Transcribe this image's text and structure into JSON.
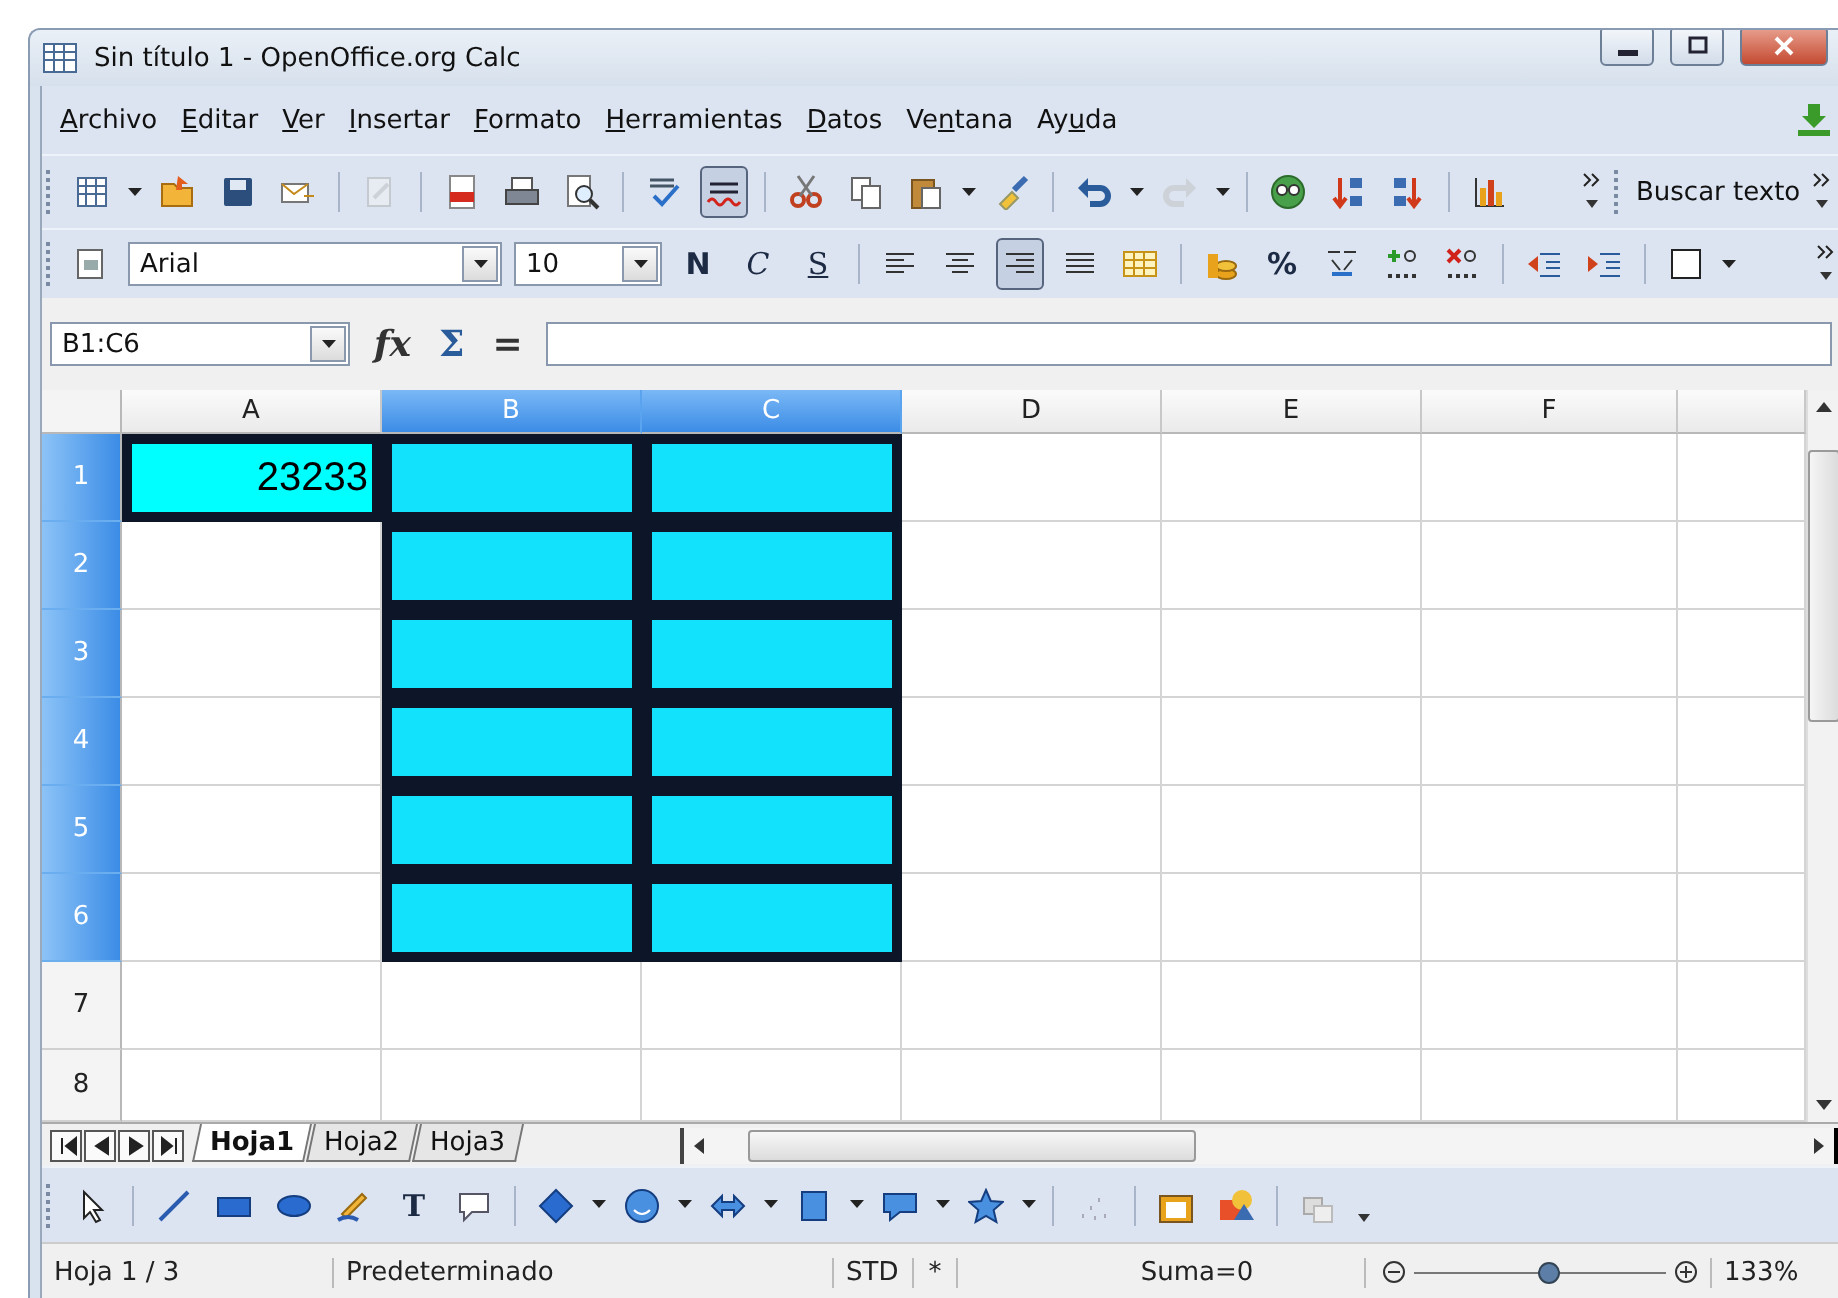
{
  "window": {
    "title": "Sin título 1 - OpenOffice.org Calc"
  },
  "menu": [
    {
      "key": "A",
      "post": "rchivo"
    },
    {
      "key": "E",
      "post": "ditar"
    },
    {
      "key": "V",
      "post": "er"
    },
    {
      "key": "I",
      "post": "nsertar"
    },
    {
      "key": "F",
      "post": "ormato"
    },
    {
      "key": "H",
      "post": "erramientas"
    },
    {
      "key": "D",
      "post": "atos"
    },
    {
      "pre": "Ve",
      "key": "n",
      "post": "tana"
    },
    {
      "pre": "Ay",
      "key": "u",
      "post": "da"
    }
  ],
  "standard_toolbar": {
    "auto_spellcheck": {
      "on": true
    },
    "edit_file": {
      "disabled": true
    },
    "redo": {
      "disabled": true
    },
    "find_label": "Buscar texto"
  },
  "format_toolbar": {
    "font": "Arial",
    "size": "10",
    "bold_glyph": "N",
    "italic_glyph": "C",
    "underline_glyph": "S",
    "percent_glyph": "%",
    "align_right": {
      "on": true
    }
  },
  "formula_bar": {
    "name_box": "B1:C6",
    "function_glyph": "fx",
    "sum_glyph": "Σ",
    "equals_glyph": "="
  },
  "columns": [
    {
      "label": "A",
      "selected": false
    },
    {
      "label": "B",
      "selected": true
    },
    {
      "label": "C",
      "selected": true
    },
    {
      "label": "D",
      "selected": false
    },
    {
      "label": "E",
      "selected": false
    },
    {
      "label": "F",
      "selected": false
    }
  ],
  "rows": [
    {
      "label": "1",
      "selected": true,
      "cells": [
        {
          "value": "23233",
          "color": "#00ffff"
        },
        {
          "color": "#12e2fb"
        },
        {
          "color": "#12e2fb"
        }
      ]
    },
    {
      "label": "2",
      "selected": true,
      "cells": [
        {},
        {
          "color": "#12e2fb"
        },
        {
          "color": "#12e2fb"
        }
      ]
    },
    {
      "label": "3",
      "selected": true,
      "cells": [
        {},
        {
          "color": "#12e2fb"
        },
        {
          "color": "#12e2fb"
        }
      ]
    },
    {
      "label": "4",
      "selected": true,
      "cells": [
        {},
        {
          "color": "#12e2fb"
        },
        {
          "color": "#12e2fb"
        }
      ]
    },
    {
      "label": "5",
      "selected": true,
      "cells": [
        {},
        {
          "color": "#12e2fb"
        },
        {
          "color": "#12e2fb"
        }
      ]
    },
    {
      "label": "6",
      "selected": true,
      "cells": [
        {},
        {
          "color": "#12e2fb"
        },
        {
          "color": "#12e2fb"
        }
      ]
    },
    {
      "label": "7",
      "selected": false,
      "cells": []
    },
    {
      "label": "8",
      "selected": false,
      "cells": []
    }
  ],
  "sheet_tabs": [
    {
      "label": "Hoja1",
      "selected": true
    },
    {
      "label": "Hoja2",
      "selected": false
    },
    {
      "label": "Hoja3",
      "selected": false
    }
  ],
  "drawing_toolbar": {
    "text_glyph": "T"
  },
  "status_bar": {
    "sheet": "Hoja 1 / 3",
    "style": "Predeterminado",
    "mode": "STD",
    "modified": "*",
    "sum": "Suma=0",
    "zoom": {
      "level": 0.53
    },
    "zoom_label": "133%"
  }
}
